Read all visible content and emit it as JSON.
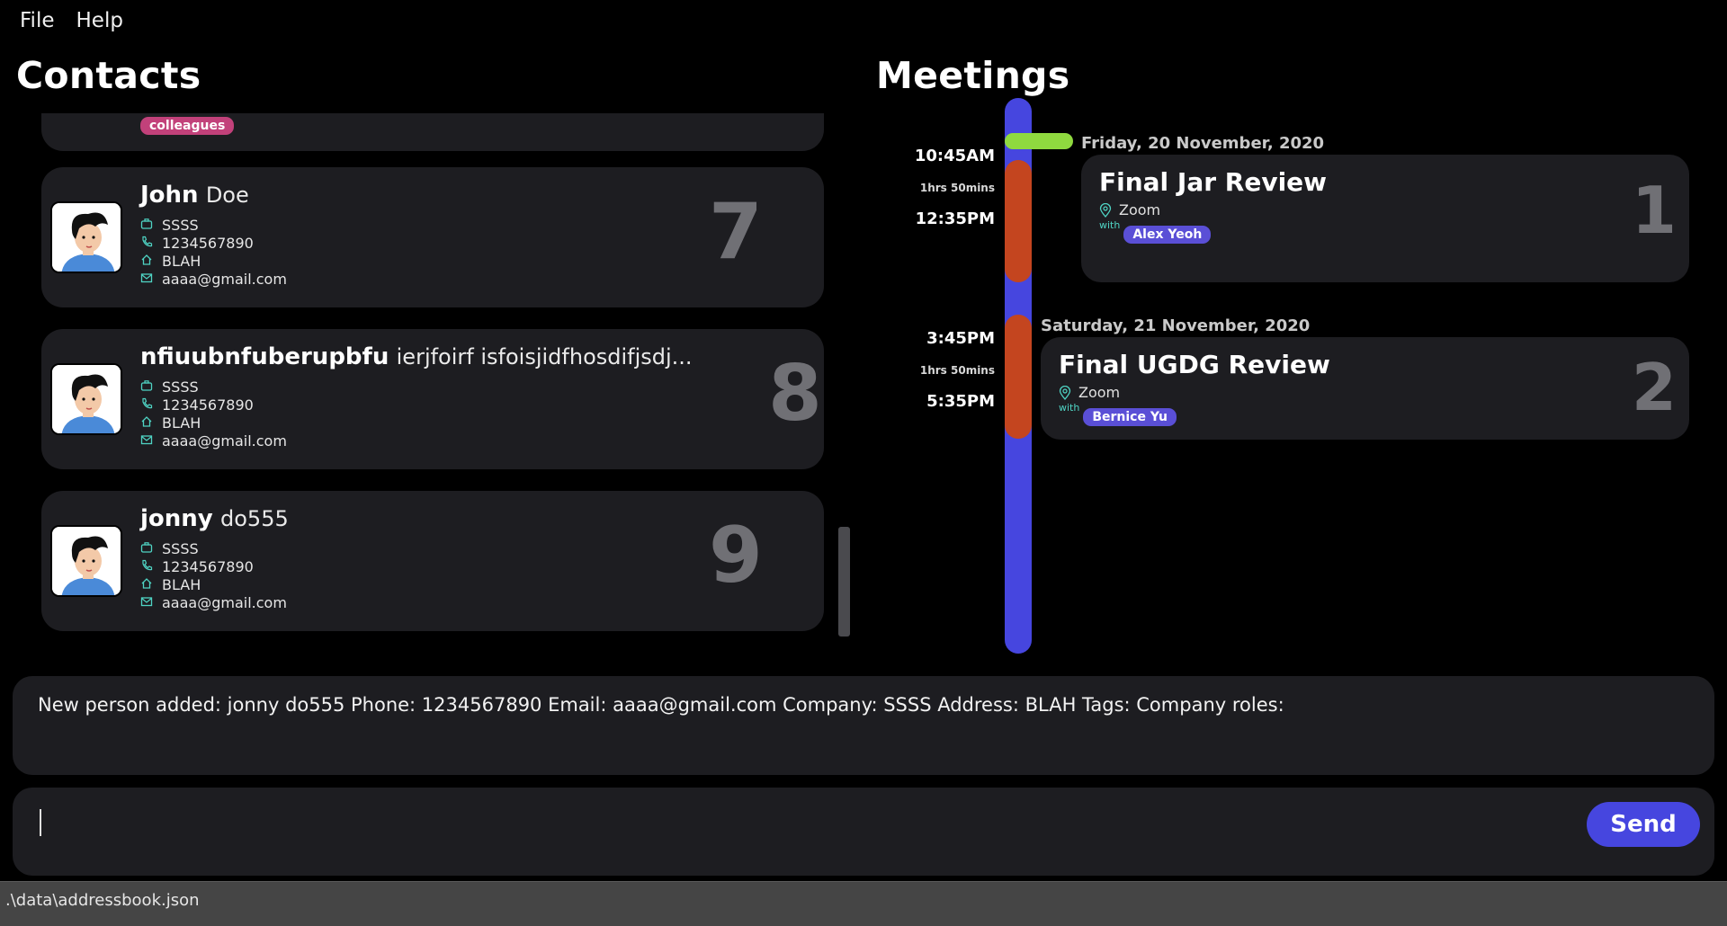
{
  "menu": {
    "file": "File",
    "help": "Help"
  },
  "contacts": {
    "title": "Contacts",
    "partial_tag": "colleagues",
    "people": [
      {
        "first": "John",
        "last": "Doe",
        "company": "SSSS",
        "phone": "1234567890",
        "address": "BLAH",
        "email": "aaaa@gmail.com",
        "index": "7"
      },
      {
        "first": "nfiuubnfuberupbfu",
        "last": "ierjfoirf isfoisjidfhosdifjsdj...",
        "company": "SSSS",
        "phone": "1234567890",
        "address": "BLAH",
        "email": "aaaa@gmail.com",
        "index": "8"
      },
      {
        "first": "jonny",
        "last": "do555",
        "company": "SSSS",
        "phone": "1234567890",
        "address": "BLAH",
        "email": "aaaa@gmail.com",
        "index": "9"
      }
    ]
  },
  "meetings": {
    "title": "Meetings",
    "items": [
      {
        "date": "Friday, 20 November, 2020",
        "start": "10:45AM",
        "duration": "1hrs 50mins",
        "end": "12:35PM",
        "title": "Final Jar Review",
        "location": "Zoom",
        "with_label": "with",
        "participant": "Alex Yeoh",
        "index": "1"
      },
      {
        "date": "Saturday, 21 November, 2020",
        "start": "3:45PM",
        "duration": "1hrs 50mins",
        "end": "5:35PM",
        "title": "Final UGDG Review",
        "location": "Zoom",
        "with_label": "with",
        "participant": "Bernice Yu",
        "index": "2"
      }
    ]
  },
  "result": {
    "text": "New person added: jonny do555 Phone: 1234567890 Email: aaaa@gmail.com Company: SSSS Address: BLAH Tags:  Company roles:"
  },
  "command": {
    "value": "",
    "send_label": "Send"
  },
  "status": {
    "path": ".\\data\\addressbook.json"
  },
  "colors": {
    "accent": "#4646df",
    "meeting_block": "#c4451f",
    "now_marker": "#8fd93f",
    "tag": "#c2417a",
    "participant": "#5a4fd6",
    "card": "#1d1d21"
  }
}
